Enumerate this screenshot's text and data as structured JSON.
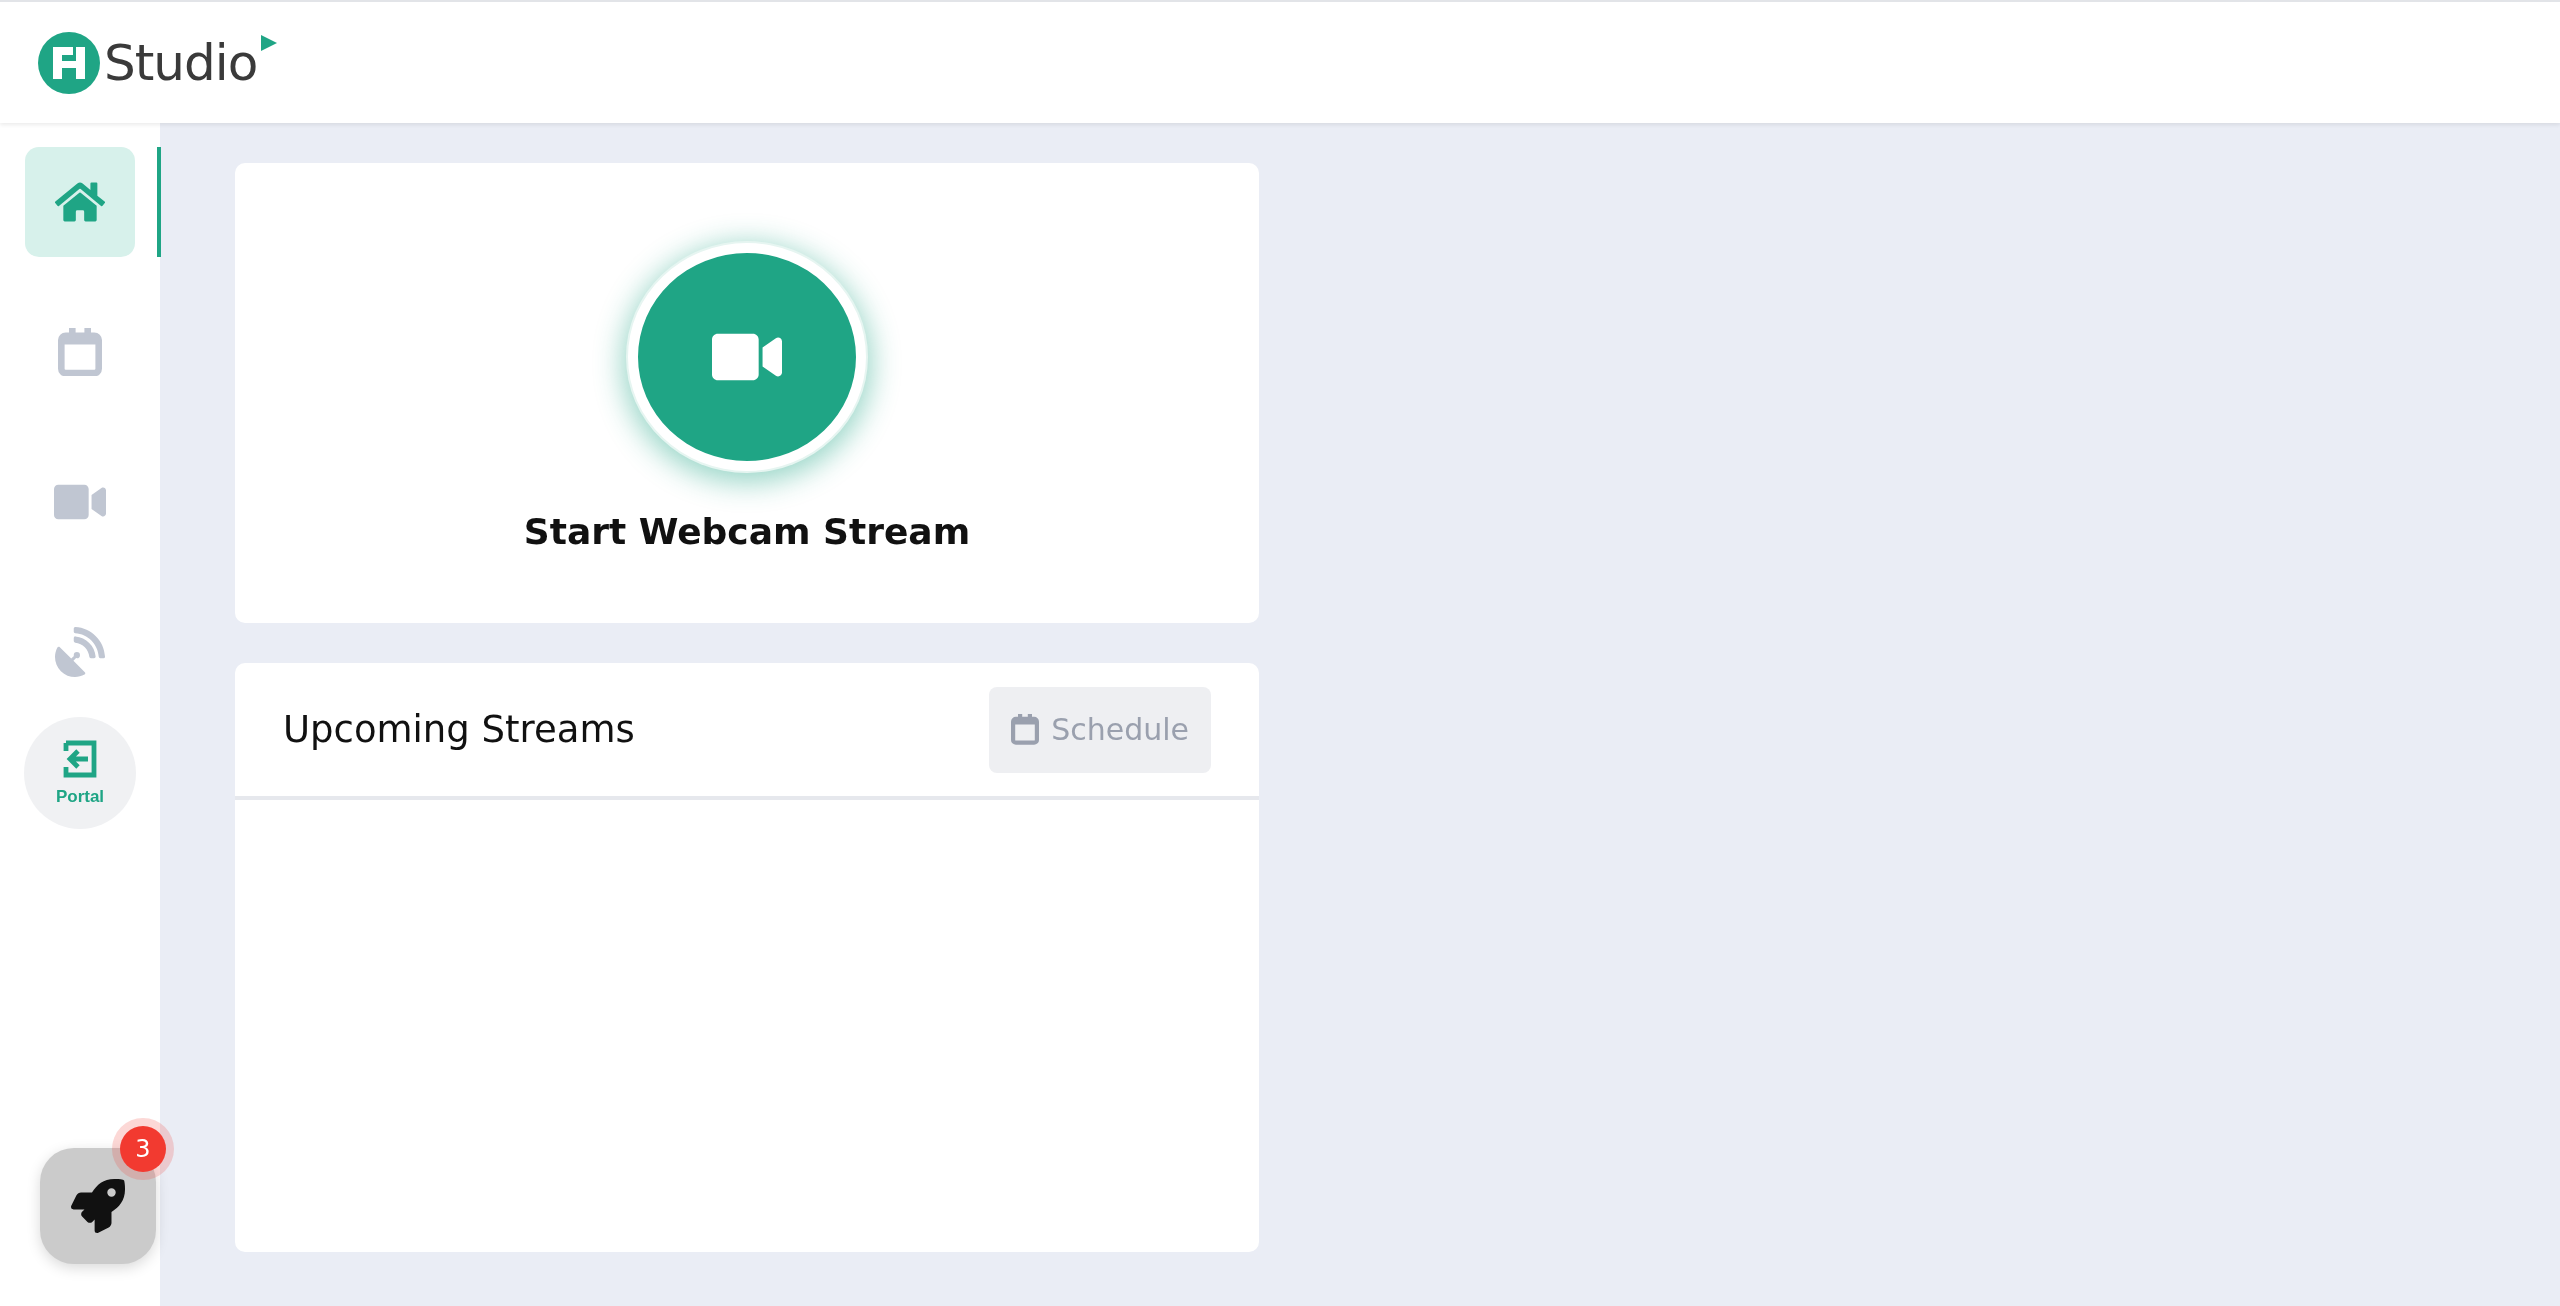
{
  "header": {
    "logo_text": "Studio"
  },
  "nav": [
    {
      "kind": "home",
      "selected": true
    },
    {
      "kind": "calendar",
      "selected": false
    },
    {
      "kind": "video",
      "selected": false
    },
    {
      "kind": "satellite",
      "selected": false
    },
    {
      "kind": "portal",
      "label": "Portal",
      "selected": false
    }
  ],
  "launcher": {
    "badge": "3"
  },
  "start_card": {
    "title": "Start Webcam Stream"
  },
  "upcoming": {
    "title": "Upcoming Streams",
    "button": "Schedule"
  }
}
